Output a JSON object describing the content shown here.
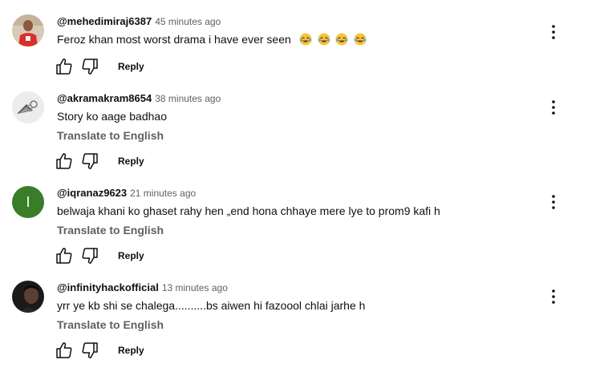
{
  "comments": [
    {
      "handle": "@mehedimiraj6387",
      "time": "45 minutes ago",
      "text": "Feroz khan most worst drama i have ever seen",
      "emojis": [
        "face-with-tears-of-joy",
        "face-with-tears-of-joy",
        "face-with-tears-of-joy",
        "face-with-tears-of-joy"
      ],
      "reply_label": "Reply"
    },
    {
      "handle": "@akramakram8654",
      "time": "38 minutes ago",
      "text": "Story ko aage badhao",
      "translate_label": "Translate to English",
      "reply_label": "Reply"
    },
    {
      "handle": "@iqranaz9623",
      "time": "21 minutes ago",
      "text": "belwaja khani ko ghaset rahy hen „end hona chhaye mere lye to prom9 kafi h",
      "translate_label": "Translate to English",
      "avatar_letter": "I",
      "avatar_color": "#3a7d28",
      "reply_label": "Reply"
    },
    {
      "handle": "@infinityhackofficial",
      "time": "13 minutes ago",
      "text": "yrr ye kb shi se chalega..........bs aiwen hi fazoool chlai jarhe h",
      "translate_label": "Translate to English",
      "reply_label": "Reply"
    }
  ],
  "icons": {
    "like": "thumb-up-icon",
    "dislike": "thumb-down-icon",
    "menu": "more-vert-icon"
  }
}
